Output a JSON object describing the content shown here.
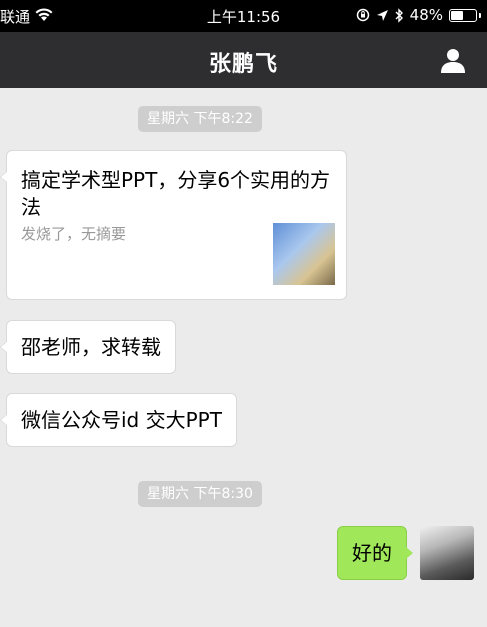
{
  "status_bar": {
    "carrier": "联通",
    "time": "上午11:56",
    "battery_percent": "48%",
    "battery_level": 0.48
  },
  "nav": {
    "title": "张鹏飞",
    "profile_icon": "person-icon"
  },
  "messages": [
    {
      "type": "timestamp",
      "text": "星期六 下午8:22"
    },
    {
      "type": "link",
      "title": "搞定学术型PPT，分享6个实用的方法",
      "desc": "发烧了，无摘要",
      "side": "left"
    },
    {
      "type": "text",
      "text": "邵老师，求转载",
      "side": "left"
    },
    {
      "type": "text",
      "text": "微信公众号id  交大PPT",
      "side": "left"
    },
    {
      "type": "timestamp",
      "text": "星期六 下午8:30"
    },
    {
      "type": "text",
      "text": "好的",
      "side": "right"
    }
  ],
  "colors": {
    "nav_bg": "#2e2e31",
    "chat_bg": "#ebebeb",
    "sent_bubble": "#a0e75a",
    "received_bubble": "#ffffff"
  }
}
